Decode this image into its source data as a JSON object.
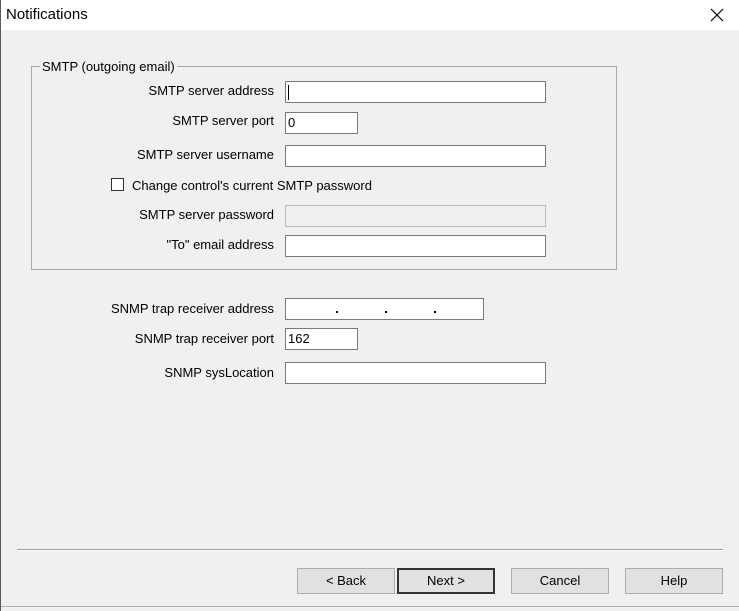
{
  "window": {
    "title": "Notifications"
  },
  "smtp": {
    "group_label": "SMTP (outgoing email)",
    "server_address_label": "SMTP server address",
    "server_address_value": "",
    "server_port_label": "SMTP server port",
    "server_port_value": "0",
    "username_label": "SMTP server username",
    "username_value": "",
    "change_password_label": "Change control's current SMTP password",
    "change_password_checked": false,
    "password_label": "SMTP server password",
    "password_value": "",
    "to_address_label": "\"To\" email address",
    "to_address_value": ""
  },
  "snmp": {
    "trap_address_label": "SNMP trap receiver address",
    "trap_port_label": "SNMP trap receiver port",
    "trap_port_value": "162",
    "syslocation_label": "SNMP sysLocation",
    "syslocation_value": ""
  },
  "buttons": {
    "back": "< Back",
    "next": "Next >",
    "cancel": "Cancel",
    "help": "Help"
  },
  "colors": {
    "dialog_background": "#f0f0f0",
    "input_background": "#ffffff",
    "disabled_input_background": "#f0f0f0"
  },
  "icons": {
    "close": "close-icon"
  }
}
